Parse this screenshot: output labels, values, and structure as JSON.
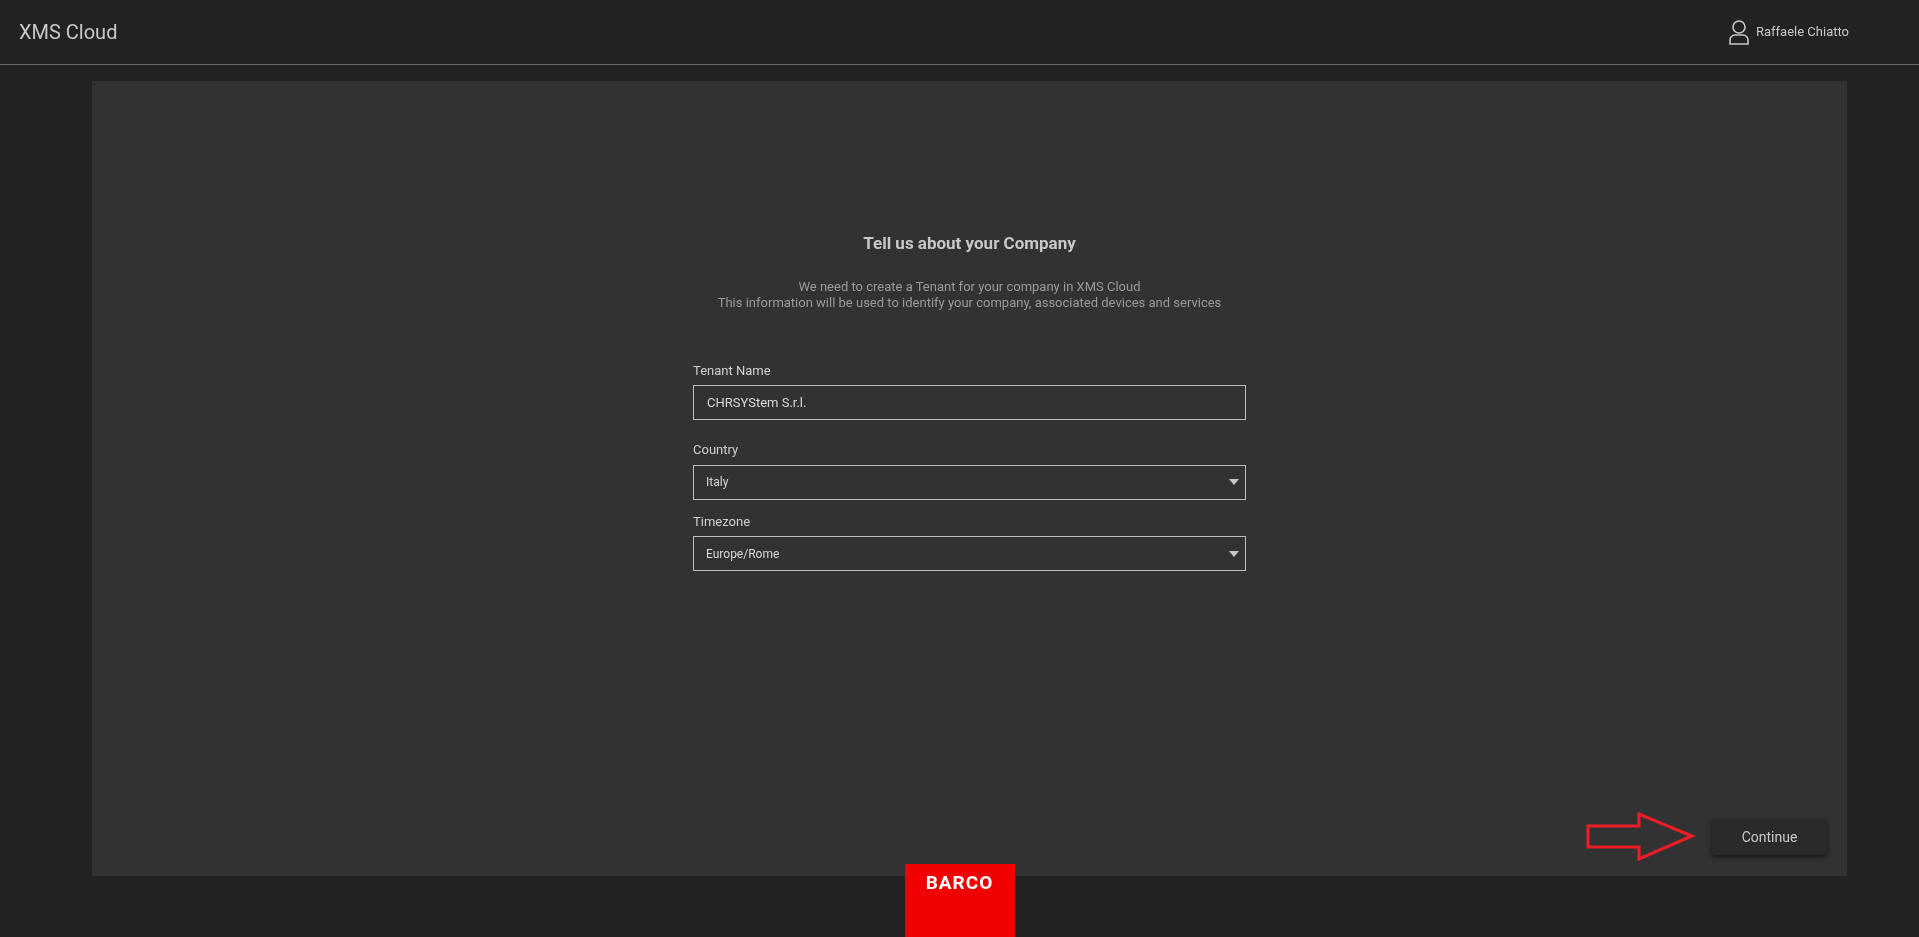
{
  "header": {
    "title": "XMS Cloud",
    "user": "Raffaele Chiatto"
  },
  "form": {
    "title": "Tell us about your Company",
    "intro": [
      "We need to create a Tenant for your company in XMS Cloud",
      "This information will be used to identify your company, associated devices and services"
    ],
    "fields": [
      {
        "kind": "text",
        "label": "Tenant Name",
        "value": "CHRSYStem S.r.l."
      },
      {
        "kind": "select",
        "label": "Country",
        "value": "Italy"
      },
      {
        "kind": "select",
        "label": "Timezone",
        "value": "Europe/Rome"
      }
    ]
  },
  "continue_button": "Continue",
  "footer_logo": "BARCO"
}
